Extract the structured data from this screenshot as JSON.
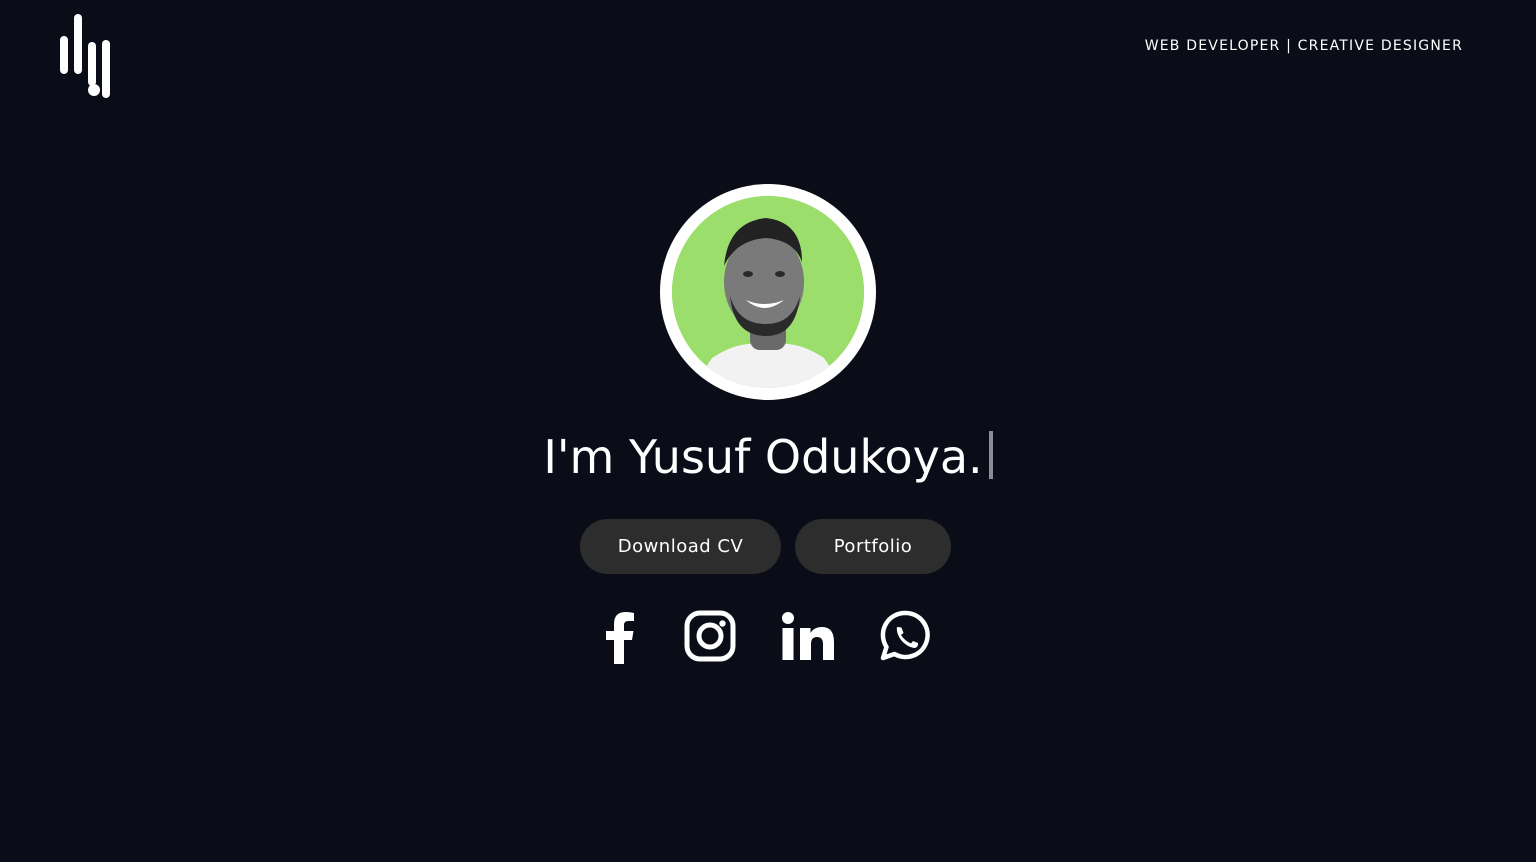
{
  "header": {
    "tagline": "WEB DEVELOPER | CREATIVE DESIGNER",
    "logo_icon": "brand-logo-icon"
  },
  "hero": {
    "avatar_background": "#9bde6c",
    "headline": "I'm Yusuf Odukoya.",
    "buttons": {
      "download_cv": "Download CV",
      "portfolio": "Portfolio"
    }
  },
  "social": [
    {
      "name": "facebook",
      "icon": "facebook-icon"
    },
    {
      "name": "instagram",
      "icon": "instagram-icon"
    },
    {
      "name": "linkedin",
      "icon": "linkedin-icon"
    },
    {
      "name": "whatsapp",
      "icon": "whatsapp-icon"
    }
  ],
  "colors": {
    "background": "#0a0c17",
    "button": "#2d2d2d",
    "text": "#ffffff"
  }
}
